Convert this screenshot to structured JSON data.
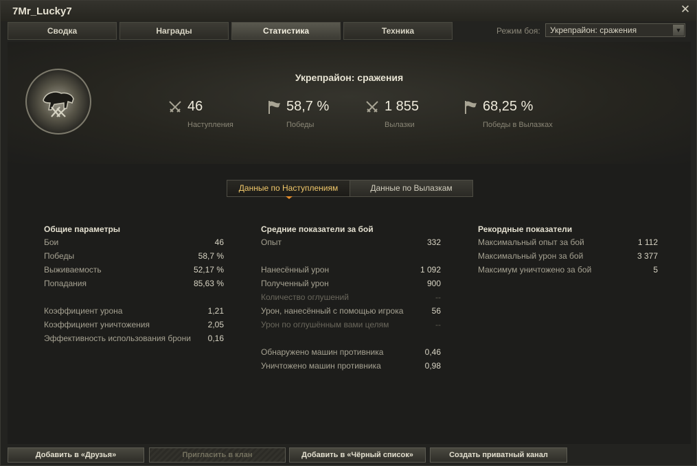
{
  "window": {
    "title": "7Mr_Lucky7",
    "close_glyph": "✕"
  },
  "tabs": [
    {
      "label": "Сводка",
      "active": false
    },
    {
      "label": "Награды",
      "active": false
    },
    {
      "label": "Статистика",
      "active": true
    },
    {
      "label": "Техника",
      "active": false
    }
  ],
  "mode": {
    "label": "Режим боя:",
    "selected": "Укрепрайон: сражения",
    "arrow": "▼"
  },
  "banner": {
    "title": "Укрепрайон: сражения",
    "emblem_icon": "bison-emblem-icon",
    "stats": [
      {
        "value": "46",
        "label": "Наступления",
        "icon": "crossed-swords-icon"
      },
      {
        "value": "58,7 %",
        "label": "Победы",
        "icon": "flag-icon"
      },
      {
        "value": "1 855",
        "label": "Вылазки",
        "icon": "crossed-swords-icon"
      },
      {
        "value": "68,25 %",
        "label": "Победы в Вылазках",
        "icon": "flag-icon"
      }
    ]
  },
  "toggle": {
    "option1": "Данные по Наступлениям",
    "option2": "Данные по Вылазкам",
    "active": 1
  },
  "columns": {
    "general": {
      "title": "Общие параметры",
      "rows": [
        {
          "k": "Бои",
          "v": "46"
        },
        {
          "k": "Победы",
          "v": "58,7 %"
        },
        {
          "k": "Выживаемость",
          "v": "52,17 %"
        },
        {
          "k": "Попадания",
          "v": "85,63 %"
        },
        {
          "k": "Коэффициент урона",
          "v": "1,21"
        },
        {
          "k": "Коэффициент уничтожения",
          "v": "2,05"
        },
        {
          "k": "Эффективность использования брони",
          "v": "0,16"
        }
      ]
    },
    "average": {
      "title": "Средние показатели за бой",
      "rows": [
        {
          "k": "Опыт",
          "v": "332"
        },
        {
          "k": "Нанесённый урон",
          "v": "1 092"
        },
        {
          "k": "Полученный урон",
          "v": "900"
        },
        {
          "k": "Количество оглушений",
          "v": "--"
        },
        {
          "k": "Урон, нанесённый с помощью игрока",
          "v": "56"
        },
        {
          "k": "Урон по оглушённым вами целям",
          "v": "--"
        },
        {
          "k": "Обнаружено машин противника",
          "v": "0,46"
        },
        {
          "k": "Уничтожено машин противника",
          "v": "0,98"
        }
      ]
    },
    "records": {
      "title": "Рекордные показатели",
      "rows": [
        {
          "k": "Максимальный опыт за бой",
          "v": "1 112"
        },
        {
          "k": "Максимальный урон за бой",
          "v": "3 377"
        },
        {
          "k": "Максимум уничтожено за бой",
          "v": "5"
        }
      ]
    }
  },
  "footer": {
    "add_friend": "Добавить в «Друзья»",
    "invite_clan": "Пригласить в клан",
    "add_blacklist": "Добавить в «Чёрный список»",
    "private_channel": "Создать приватный канал"
  }
}
